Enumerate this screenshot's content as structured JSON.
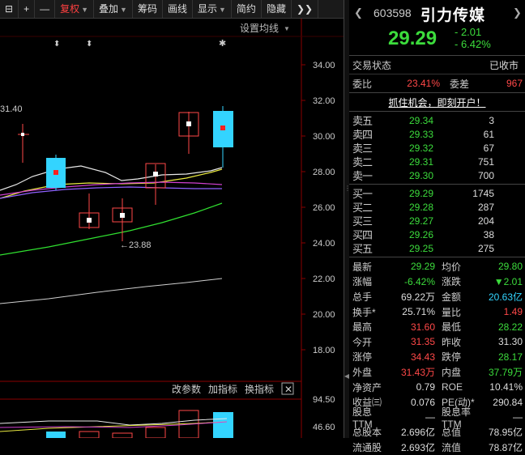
{
  "toolbar": {
    "items": [
      {
        "label": "⊟",
        "active": false
      },
      {
        "label": "+",
        "active": false
      },
      {
        "label": "—",
        "active": false
      },
      {
        "label": "复权",
        "active": true,
        "arrow": true
      },
      {
        "label": "叠加",
        "active": false,
        "arrow": true
      },
      {
        "label": "筹码",
        "active": false
      },
      {
        "label": "画线",
        "active": false
      },
      {
        "label": "显示",
        "active": false,
        "arrow": true
      },
      {
        "label": "简约",
        "active": false
      },
      {
        "label": "隐藏",
        "active": false
      },
      {
        "label": "❯❯",
        "active": false
      }
    ]
  },
  "chart": {
    "settings_label": "设置均线",
    "y_ticks": [
      "34.00",
      "32.00",
      "30.00",
      "28.00",
      "26.00",
      "24.00",
      "22.00",
      "20.00",
      "18.00"
    ],
    "high_label": "31.40",
    "low_label": "←23.88",
    "indicator_tabs": [
      "改参数",
      "加指标",
      "换指标"
    ],
    "indicator_y_ticks": [
      "94.50",
      "46.60"
    ]
  },
  "quote": {
    "code": "603598",
    "name": "引力传媒",
    "price": "29.29",
    "change": "- 2.01",
    "change_pct": "- 6.42%",
    "status_label": "交易状态",
    "status_value": "已收市",
    "weibi_label": "委比",
    "weibi_value": "23.41%",
    "weicha_label": "委差",
    "weicha_value": "967",
    "ad_text": "抓住机会，即刻开户！"
  },
  "orderbook": {
    "asks": [
      {
        "label": "卖五",
        "price": "29.34",
        "vol": "3"
      },
      {
        "label": "卖四",
        "price": "29.33",
        "vol": "61"
      },
      {
        "label": "卖三",
        "price": "29.32",
        "vol": "67"
      },
      {
        "label": "卖二",
        "price": "29.31",
        "vol": "751"
      },
      {
        "label": "卖一",
        "price": "29.30",
        "vol": "700"
      }
    ],
    "bids": [
      {
        "label": "买一",
        "price": "29.29",
        "vol": "1745"
      },
      {
        "label": "买二",
        "price": "29.28",
        "vol": "287"
      },
      {
        "label": "买三",
        "price": "29.27",
        "vol": "204"
      },
      {
        "label": "买四",
        "price": "29.26",
        "vol": "38"
      },
      {
        "label": "买五",
        "price": "29.25",
        "vol": "275"
      }
    ]
  },
  "stats": [
    {
      "k1": "最新",
      "v1": "29.29",
      "c1": "g",
      "k2": "均价",
      "v2": "29.80",
      "c2": "g"
    },
    {
      "k1": "涨幅",
      "v1": "-6.42%",
      "c1": "g",
      "k2": "涨跌",
      "v2": "▼2.01",
      "c2": "g"
    },
    {
      "k1": "总手",
      "v1": "69.22万",
      "c1": "w",
      "k2": "金额",
      "v2": "20.63亿",
      "c2": "c"
    },
    {
      "k1": "换手*",
      "v1": "25.71%",
      "c1": "w",
      "k2": "量比",
      "v2": "1.49",
      "c2": "r"
    },
    {
      "k1": "最高",
      "v1": "31.60",
      "c1": "r",
      "k2": "最低",
      "v2": "28.22",
      "c2": "g"
    },
    {
      "k1": "今开",
      "v1": "31.35",
      "c1": "r",
      "k2": "昨收",
      "v2": "31.30",
      "c2": "w"
    },
    {
      "k1": "涨停",
      "v1": "34.43",
      "c1": "r",
      "k2": "跌停",
      "v2": "28.17",
      "c2": "g"
    },
    {
      "k1": "外盘",
      "v1": "31.43万",
      "c1": "r",
      "k2": "内盘",
      "v2": "37.79万",
      "c2": "g"
    },
    {
      "k1": "净资产",
      "v1": "0.79",
      "c1": "w",
      "k2": "ROE",
      "v2": "10.41%",
      "c2": "w"
    },
    {
      "k1": "收益㈢",
      "v1": "0.076",
      "c1": "w",
      "k2": "PE(动)*",
      "v2": "290.84",
      "c2": "w"
    },
    {
      "k1": "股息TTM",
      "v1": "—",
      "c1": "w",
      "k2": "股息率TTM",
      "v2": "—",
      "c2": "w"
    },
    {
      "k1": "总股本",
      "v1": "2.696亿",
      "c1": "w",
      "k2": "总值",
      "v2": "78.95亿",
      "c2": "w"
    },
    {
      "k1": "流通股",
      "v1": "2.693亿",
      "c1": "w",
      "k2": "流值",
      "v2": "78.87亿",
      "c2": "w"
    }
  ],
  "colors": {
    "up": "#ff4848",
    "down": "#3cdc3c",
    "cyan": "#33d4ff",
    "axis": "#8a0000"
  }
}
